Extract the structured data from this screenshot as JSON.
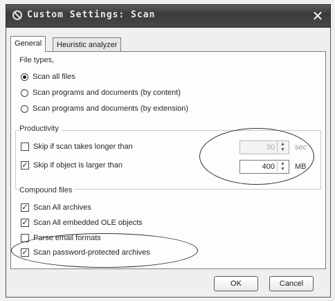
{
  "window": {
    "title": "Custom Settings: Scan",
    "close_label": "✕"
  },
  "tabs": [
    {
      "label": "General",
      "active": true
    },
    {
      "label": "Heuristic analyzer",
      "active": false
    }
  ],
  "file_types": {
    "title": "File types",
    "options": [
      {
        "label": "Scan all files",
        "selected": true
      },
      {
        "label": "Scan programs and documents (by content)",
        "selected": false
      },
      {
        "label": "Scan programs and documents (by extension)",
        "selected": false
      }
    ]
  },
  "productivity": {
    "title": "Productivity",
    "skip_time": {
      "label": "Skip if scan takes longer than",
      "checked": false,
      "value": "30",
      "unit": "sec",
      "enabled": false
    },
    "skip_size": {
      "label": "Skip if object is larger than",
      "checked": true,
      "value": "400",
      "unit": "MB",
      "enabled": true
    }
  },
  "compound": {
    "title": "Compound files",
    "items": [
      {
        "label": "Scan All archives",
        "checked": true
      },
      {
        "label": "Scan All embedded OLE objects",
        "checked": true
      },
      {
        "label": "Parse email formats",
        "checked": false
      },
      {
        "label": "Scan password-protected archives",
        "checked": true
      }
    ]
  },
  "buttons": {
    "ok": "OK",
    "cancel": "Cancel"
  }
}
